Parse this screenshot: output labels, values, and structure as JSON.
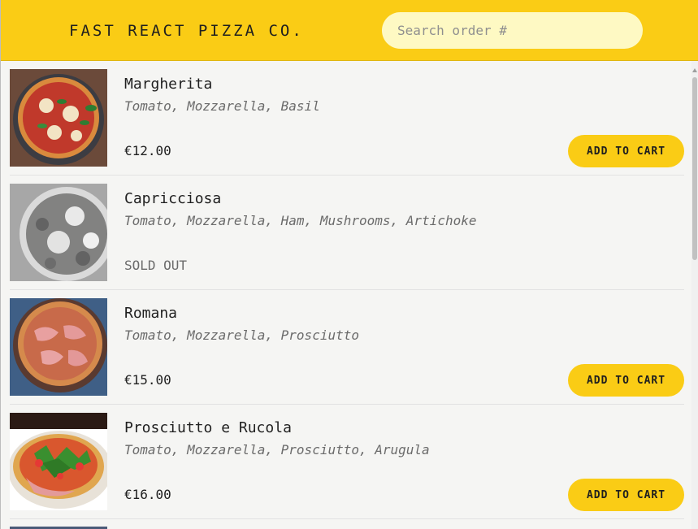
{
  "header": {
    "logo": "FAST REACT PIZZA CO.",
    "search_placeholder": "Search order #"
  },
  "menu": [
    {
      "name": "Margherita",
      "ingredients": "Tomato, Mozzarella, Basil",
      "price": "€12.00",
      "sold_out": false,
      "button": "ADD TO CART",
      "image_icon": "pizza-margherita-image"
    },
    {
      "name": "Capricciosa",
      "ingredients": "Tomato, Mozzarella, Ham, Mushrooms, Artichoke",
      "status": "SOLD OUT",
      "sold_out": true,
      "image_icon": "pizza-capricciosa-image"
    },
    {
      "name": "Romana",
      "ingredients": "Tomato, Mozzarella, Prosciutto",
      "price": "€15.00",
      "sold_out": false,
      "button": "ADD TO CART",
      "image_icon": "pizza-romana-image"
    },
    {
      "name": "Prosciutto e Rucola",
      "ingredients": "Tomato, Mozzarella, Prosciutto, Arugula",
      "price": "€16.00",
      "sold_out": false,
      "button": "ADD TO CART",
      "image_icon": "pizza-prosciutto-rucola-image"
    }
  ],
  "colors": {
    "accent": "#facc15",
    "search_bg": "#fef9c3",
    "page_bg": "#f5f5f3",
    "muted_text": "#6b6b6b"
  }
}
